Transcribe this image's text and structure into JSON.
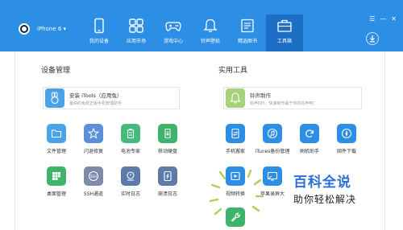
{
  "header": {
    "device_name": "iPhone 6 ▾",
    "nav": [
      {
        "label": "我的设备",
        "icon": "phone-icon"
      },
      {
        "label": "应用市场",
        "icon": "apps-icon"
      },
      {
        "label": "游戏中心",
        "icon": "gamepad-icon"
      },
      {
        "label": "铃声壁纸",
        "icon": "bell-icon"
      },
      {
        "label": "精选图书",
        "icon": "book-icon"
      },
      {
        "label": "工具箱",
        "icon": "toolbox-icon"
      }
    ],
    "active_tab": "工具箱",
    "window_controls": [
      "☰",
      "—",
      "✕"
    ]
  },
  "device_management": {
    "title": "设备管理",
    "featured": {
      "title": "安装 iTools（应用兔）",
      "subtitle": "最快的免费正版手机管理助手",
      "icon": "rabbit-icon"
    },
    "tools": [
      {
        "label": "文件管理",
        "icon": "folder-icon",
        "color": "#4aa3e8"
      },
      {
        "label": "闪退修复",
        "icon": "badge-icon",
        "color": "#5b8fd8"
      },
      {
        "label": "电池专家",
        "icon": "battery-icon",
        "color": "#47b97a"
      },
      {
        "label": "移动硬盘",
        "icon": "usb-icon",
        "color": "#3fb36b"
      },
      {
        "label": "桌面管理",
        "icon": "grid-icon",
        "color": "#3fb36b"
      },
      {
        "label": "SSH通道",
        "icon": "ssh-icon",
        "color": "#7d8aa8"
      },
      {
        "label": "实时日志",
        "icon": "log-icon",
        "color": "#5d7aa8"
      },
      {
        "label": "崩溃日志",
        "icon": "crash-log-icon",
        "color": "#5d7aa8"
      }
    ]
  },
  "utilities": {
    "title": "实用工具",
    "featured": {
      "title": "铃声制作",
      "subtitle": "铃声DIY，快速制作属于你的铃声吧！",
      "icon": "bell-icon"
    },
    "tools": [
      {
        "label": "手机搬家",
        "icon": "phone-transfer-icon",
        "color": "#2d8ee6"
      },
      {
        "label": "iTunes备份管理",
        "icon": "music-icon",
        "color": "#2d8ee6"
      },
      {
        "label": "刷机助手",
        "icon": "refresh-icon",
        "color": "#2d8ee6"
      },
      {
        "label": "固件下载",
        "icon": "compass-icon",
        "color": "#2d8ee6"
      },
      {
        "label": "视频转换",
        "icon": "video-icon",
        "color": "#2d8ee6"
      },
      {
        "label": "苹果录屏大",
        "icon": "cast-icon",
        "color": "#2d8ee6"
      },
      {
        "label": "",
        "icon": "wrench-icon",
        "color": "#3fb36b"
      }
    ]
  },
  "watermark": {
    "title": "百科全说",
    "subtitle": "助你轻松解决"
  }
}
